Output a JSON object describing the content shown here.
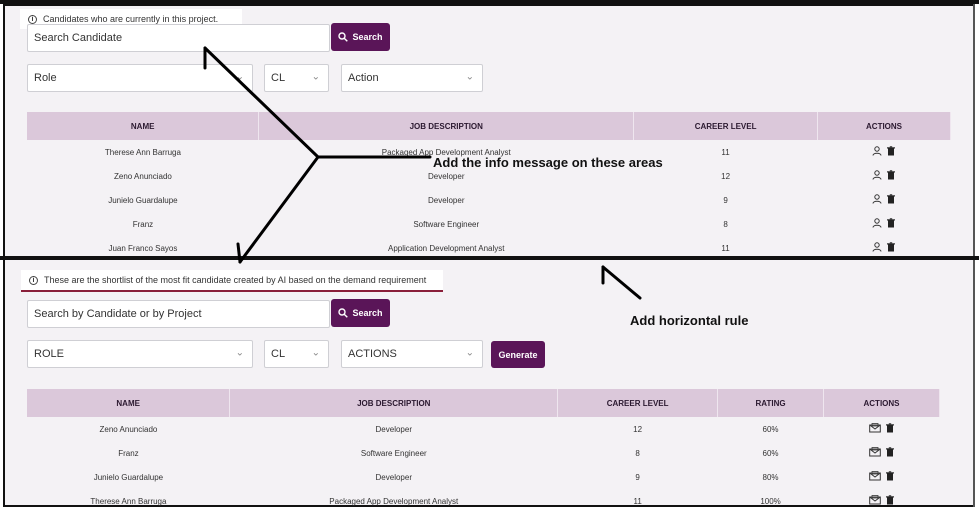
{
  "top": {
    "info_message": "Candidates who are currently in this project.",
    "search_placeholder": "Search Candidate",
    "search_button": "Search",
    "role_select": "Role",
    "cl_select": "CL",
    "action_select": "Action",
    "columns": [
      "NAME",
      "JOB DESCRIPTION",
      "CAREER LEVEL",
      "ACTIONS"
    ],
    "rows": [
      {
        "name": "Therese Ann Barruga",
        "job": "Packaged App Development Analyst",
        "level": "11"
      },
      {
        "name": "Zeno Anunciado",
        "job": "Developer",
        "level": "12"
      },
      {
        "name": "Junielo Guardalupe",
        "job": "Developer",
        "level": "9"
      },
      {
        "name": "Franz",
        "job": "Software Engineer",
        "level": "8"
      },
      {
        "name": "Juan Franco Sayos",
        "job": "Application Development Analyst",
        "level": "11"
      }
    ]
  },
  "bottom": {
    "info_message": "These are the shortlist of the most fit candidate created by AI based on the demand requirement",
    "search_placeholder": "Search by Candidate or by Project",
    "search_button": "Search",
    "role_select": "ROLE",
    "cl_select": "CL",
    "actions_select": "ACTIONS",
    "generate_button": "Generate",
    "columns": [
      "NAME",
      "JOB DESCRIPTION",
      "CAREER LEVEL",
      "RATING",
      "ACTIONS"
    ],
    "rows": [
      {
        "name": "Zeno Anunciado",
        "job": "Developer",
        "level": "12",
        "rating": "60%"
      },
      {
        "name": "Franz",
        "job": "Software Engineer",
        "level": "8",
        "rating": "60%"
      },
      {
        "name": "Junielo Guardalupe",
        "job": "Developer",
        "level": "9",
        "rating": "80%"
      },
      {
        "name": "Therese Ann Barruga",
        "job": "Packaged App Development Analyst",
        "level": "11",
        "rating": "100%"
      }
    ]
  },
  "annotations": {
    "info_note": "Add the info message on these areas",
    "rule_note": "Add horizontal rule"
  },
  "colors": {
    "accent": "#5a1558",
    "header_bg": "#dbc8da",
    "info_underline": "#8a1f3a"
  },
  "icons": [
    "info-icon",
    "search-icon",
    "chevron-down-icon",
    "user-icon",
    "trash-icon",
    "mail-icon"
  ]
}
